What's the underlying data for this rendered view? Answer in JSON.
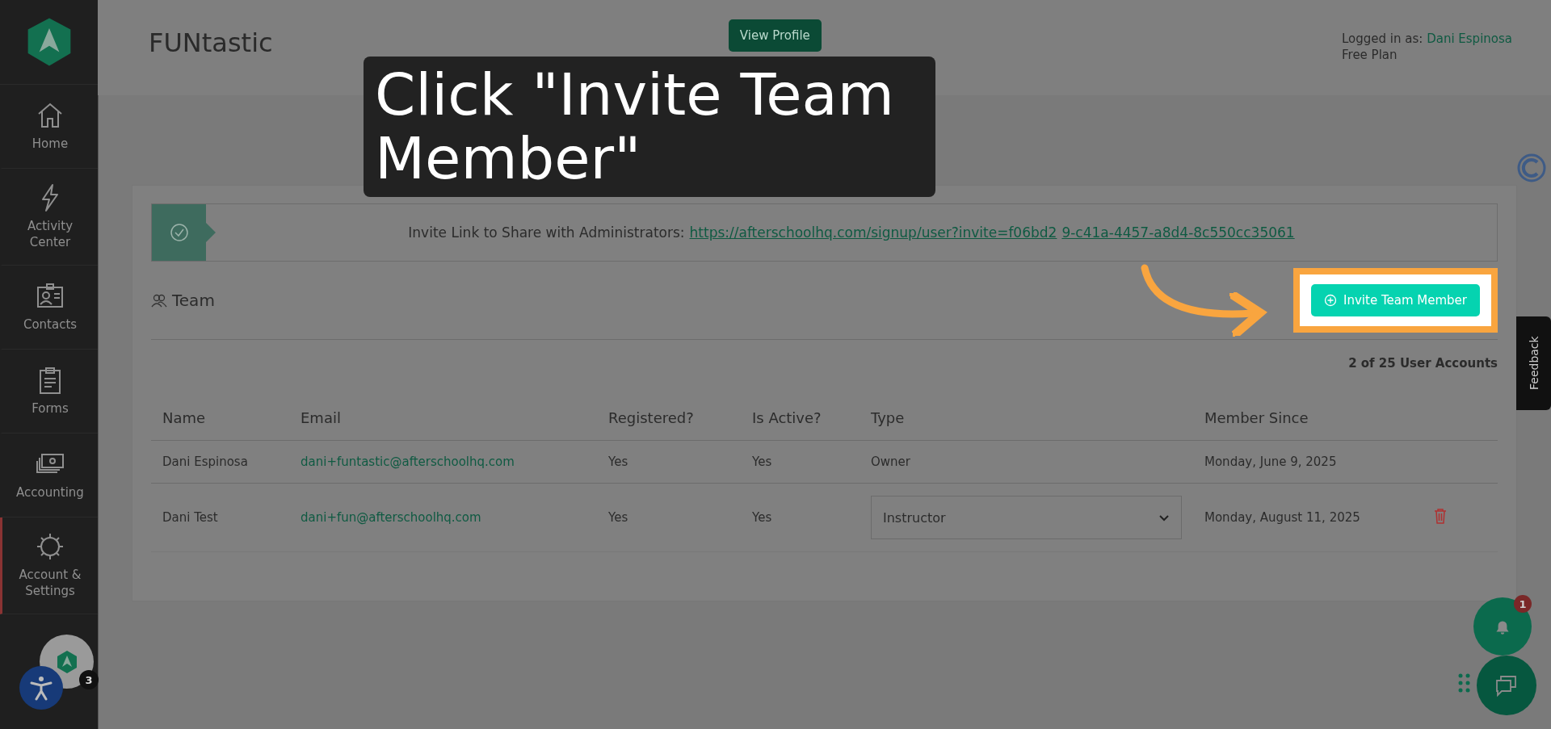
{
  "sidebar": {
    "items": [
      {
        "label": "Home",
        "selected": false
      },
      {
        "label": "Activity Center",
        "selected": false
      },
      {
        "label": "Contacts",
        "selected": false
      },
      {
        "label": "Forms",
        "selected": false
      },
      {
        "label": "Accounting",
        "selected": false
      },
      {
        "label": "Account & Settings",
        "selected": true
      }
    ],
    "badge": "3"
  },
  "header": {
    "title": "FUNtastic",
    "view_profile_button": "View Profile",
    "logged_in_label": "Logged in as:",
    "user_name": "Dani Espinosa",
    "plan": "Free Plan"
  },
  "invite_banner": {
    "label": "Invite Link to Share with Administrators:",
    "link_parts": [
      "https://afterschoolhq.com/signup/user?invite=f06bd2",
      "9-c41a-4457-a8d4-8c550cc35061"
    ]
  },
  "team": {
    "title": "Team",
    "invite_button": "Invite Team Member",
    "account_count": "2 of 25 User Accounts"
  },
  "table": {
    "columns": [
      "Name",
      "Email",
      "Registered?",
      "Is Active?",
      "Type",
      "Member Since"
    ],
    "rows": [
      {
        "kind": "text",
        "name": "Dani Espinosa",
        "email": "dani+funtastic@afterschoolhq.com",
        "registered": "Yes",
        "is_active": "Yes",
        "type": "Owner",
        "member_since": "Monday, June 9, 2025",
        "deletable": false
      },
      {
        "kind": "dropdown",
        "name": "Dani Test",
        "email": "dani+fun@afterschoolhq.com",
        "registered": "Yes",
        "is_active": "Yes",
        "type": "Instructor",
        "member_since": "Monday, August 11, 2025",
        "deletable": true
      }
    ]
  },
  "caption": "Click \"Invite Team Member\"",
  "feedback_tab": "Feedback",
  "notifications": {
    "count": "1"
  }
}
